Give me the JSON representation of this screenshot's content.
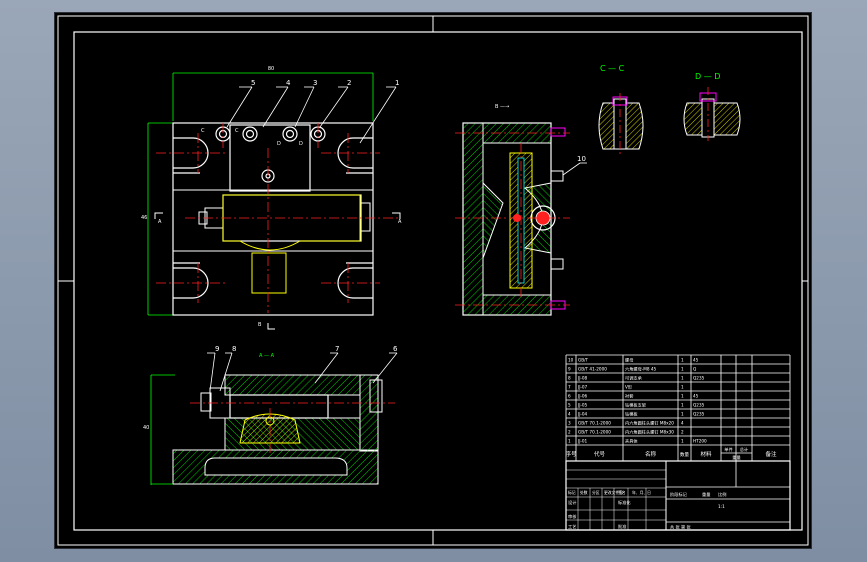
{
  "drawing": {
    "views": {
      "section_c": "C — C",
      "section_d": "D — D",
      "label_a_left": "A",
      "label_a_right": "A",
      "label_b": "B",
      "label_aa": "A — A",
      "view_arrow": "B —→"
    },
    "balloons": [
      "5",
      "4",
      "3",
      "2",
      "1",
      "10",
      "9",
      "8",
      "7",
      "6"
    ],
    "dims": {
      "top": "80",
      "left": "46",
      "bottom_left": "40"
    },
    "tiny_labels": {
      "c1": "C",
      "c2": "C",
      "d1": "D",
      "d2": "D"
    }
  },
  "bom": {
    "rows": [
      {
        "no": "10",
        "code": "GB/T",
        "name": "螺母",
        "qty": "1",
        "mat": "45"
      },
      {
        "no": "9",
        "code": "GB/T 41-2000",
        "name": "六角螺母-M8 45",
        "qty": "1",
        "mat": "Q"
      },
      {
        "no": "8",
        "code": "JJ-08",
        "name": "可调支承",
        "qty": "1",
        "mat": "Q235"
      },
      {
        "no": "7",
        "code": "JJ-07",
        "name": "V形",
        "qty": "1",
        "mat": ""
      },
      {
        "no": "6",
        "code": "JJ-06",
        "name": "衬套",
        "qty": "1",
        "mat": "45"
      },
      {
        "no": "5",
        "code": "JJ-05",
        "name": "钻模板支架",
        "qty": "1",
        "mat": "Q235"
      },
      {
        "no": "4",
        "code": "JJ-04",
        "name": "钻模板",
        "qty": "1",
        "mat": "Q235"
      },
      {
        "no": "3",
        "code": "GB/T 70.1-2000",
        "name": "内六角圆柱头螺钉 M8x20",
        "qty": "4",
        "mat": ""
      },
      {
        "no": "2",
        "code": "GB/T 70.1-2000",
        "name": "内六角圆柱头螺钉 M8x30",
        "qty": "2",
        "mat": ""
      },
      {
        "no": "1",
        "code": "JJ-01",
        "name": "夹具体",
        "qty": "1",
        "mat": "HT200"
      }
    ],
    "header": {
      "no": "序号",
      "code": "代号",
      "name": "名称",
      "qty": "数量",
      "mat": "材料",
      "unit_wt": "单件",
      "total_wt": "总计",
      "weight": "重量",
      "remark": "备注"
    }
  },
  "title_block": {
    "row1": [
      "标记",
      "处数",
      "分区",
      "更改文件号",
      "签名",
      "年、月、日"
    ],
    "design": "设计",
    "std": "标准化",
    "stage": "阶段标记",
    "weight": "重量",
    "scale": "比例",
    "scale_val": "1:1",
    "review": "审核",
    "process": "工艺",
    "approve": "批准",
    "sheets": "共 张 第 张"
  },
  "colors": {
    "canvas": "#000000",
    "frame": "#ffffff",
    "outline": "#ffffff",
    "center": "#ff2020",
    "hatch": "#00c800",
    "yellow": "#ffff00",
    "magenta": "#ff00ff",
    "cyan": "#00ffff",
    "dim": "#00ff00"
  }
}
